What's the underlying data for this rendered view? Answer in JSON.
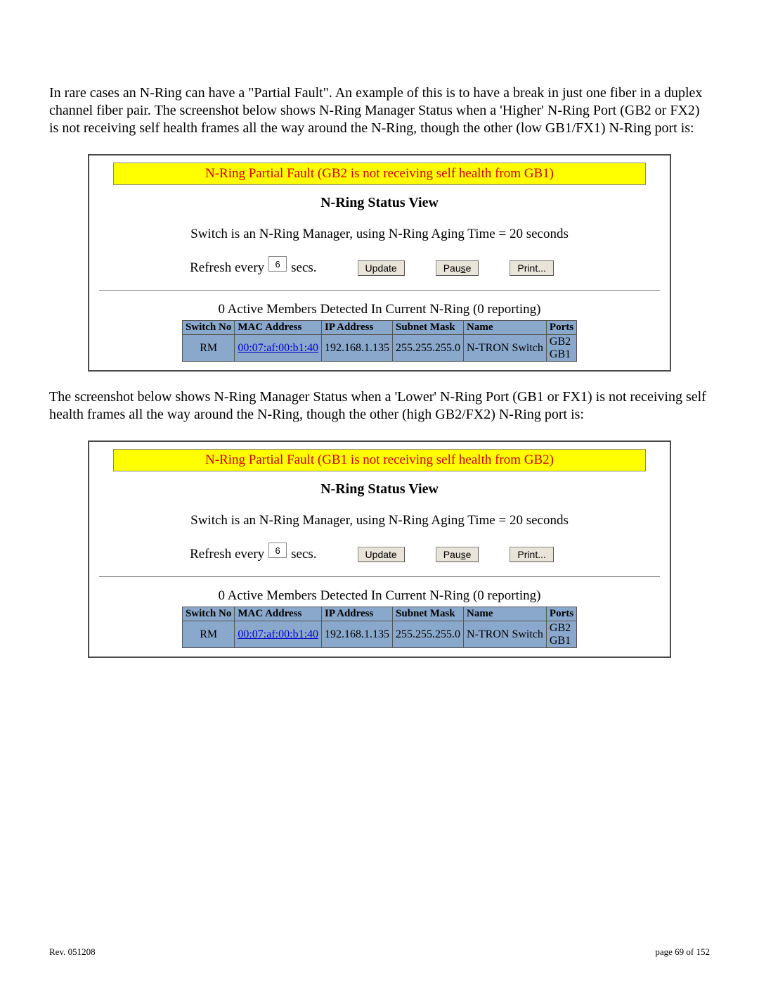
{
  "paragraph1": "In rare cases an N-Ring can have a \"Partial Fault\".  An example of this is to have a break in just one fiber in a duplex channel fiber pair.  The screenshot below shows N-Ring Manager Status when a 'Higher' N-Ring Port (GB2 or FX2) is not receiving self health frames all the way around the N-Ring, though the other (low GB1/FX1) N-Ring port is:",
  "paragraph2": "The screenshot below shows N-Ring Manager Status when a 'Lower' N-Ring Port (GB1 or FX1) is not receiving self health frames all the way around the N-Ring, though the other (high GB2/FX2) N-Ring port is:",
  "panels": [
    {
      "alert": "N-Ring Partial Fault (GB2 is not receiving self health from GB1)",
      "title": "N-Ring Status View",
      "subtitle": "Switch is an N-Ring Manager, using N-Ring Aging Time = 20 seconds",
      "refresh_label": "Refresh every",
      "refresh_value": "6",
      "secs_label": "secs.",
      "buttons": {
        "update": "Update",
        "pause": "Pause",
        "print": "Print..."
      },
      "members_line": "0 Active Members Detected In Current N-Ring (0 reporting)",
      "headers": [
        "Switch No",
        "MAC Address",
        "IP Address",
        "Subnet Mask",
        "Name",
        "Ports"
      ],
      "row": {
        "switch_no": "RM",
        "mac": "00:07:af:00:b1:40",
        "ip": "192.168.1.135",
        "mask": "255.255.255.0",
        "name": "N-TRON Switch",
        "port1": "GB2",
        "port2": "GB1"
      }
    },
    {
      "alert": "N-Ring Partial Fault (GB1 is not receiving self health from GB2)",
      "title": "N-Ring Status View",
      "subtitle": "Switch is an N-Ring Manager, using N-Ring Aging Time = 20 seconds",
      "refresh_label": "Refresh every",
      "refresh_value": "6",
      "secs_label": "secs.",
      "buttons": {
        "update": "Update",
        "pause": "Pause",
        "print": "Print..."
      },
      "members_line": "0 Active Members Detected In Current N-Ring (0 reporting)",
      "headers": [
        "Switch No",
        "MAC Address",
        "IP Address",
        "Subnet Mask",
        "Name",
        "Ports"
      ],
      "row": {
        "switch_no": "RM",
        "mac": "00:07:af:00:b1:40",
        "ip": "192.168.1.135",
        "mask": "255.255.255.0",
        "name": "N-TRON Switch",
        "port1": "GB2",
        "port2": "GB1"
      }
    }
  ],
  "footer": {
    "rev": "Rev.  051208",
    "page": "page 69 of 152"
  }
}
